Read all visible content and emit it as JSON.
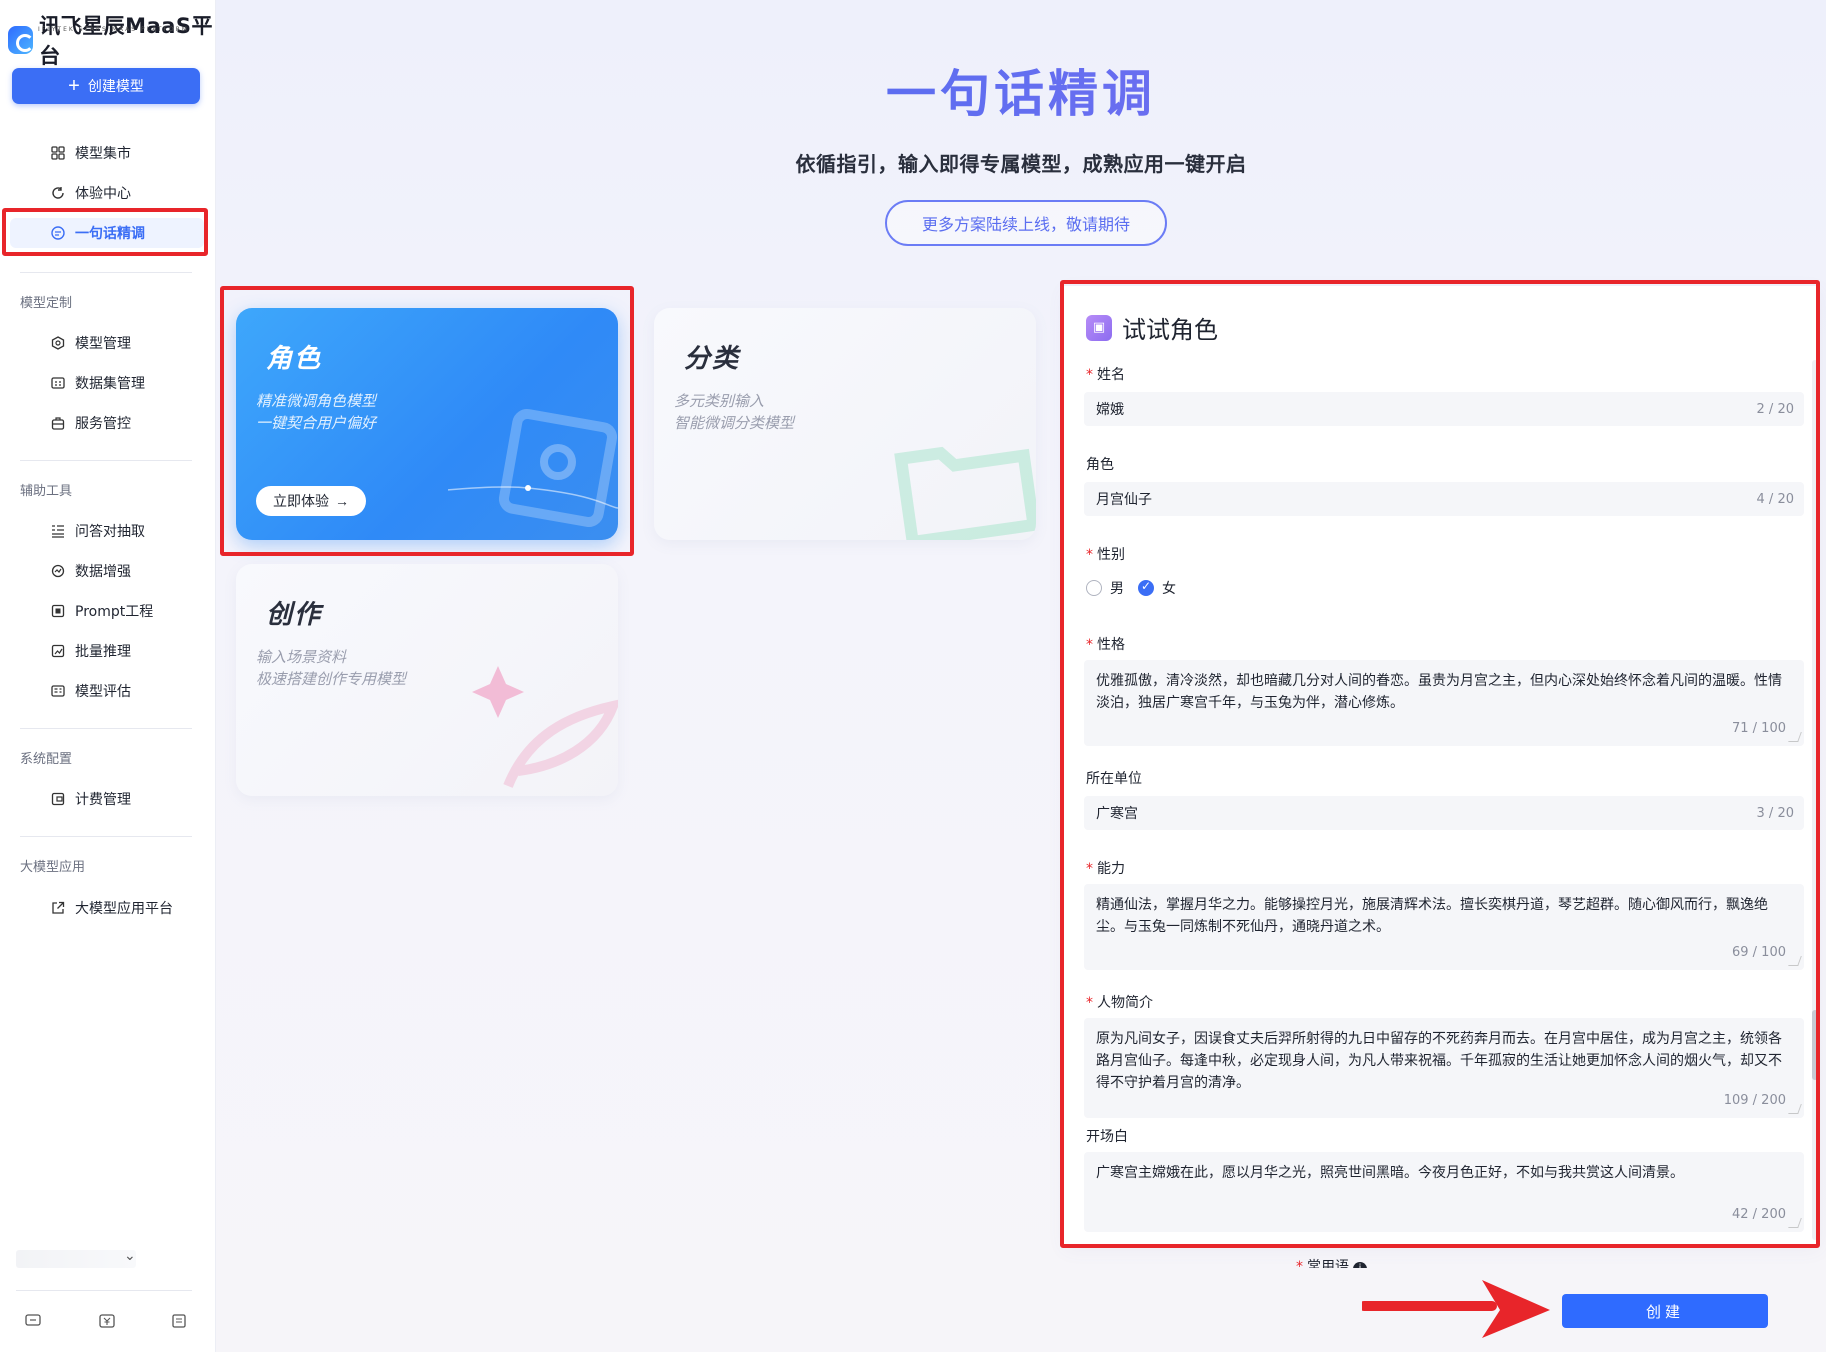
{
  "brand": {
    "name": "讯飞星辰MaaS平台",
    "subtitle": "IFLYTEK STARS MAAS PLATFORM"
  },
  "sidebar": {
    "create_button": "创建模型",
    "top_items": [
      {
        "label": "模型集市",
        "icon": "grid-icon"
      },
      {
        "label": "体验中心",
        "icon": "refresh-icon"
      },
      {
        "label": "一句话精调",
        "icon": "tune-icon",
        "active": true
      }
    ],
    "sections": [
      {
        "title": "模型定制",
        "items": [
          {
            "label": "模型管理",
            "icon": "model-icon"
          },
          {
            "label": "数据集管理",
            "icon": "dataset-icon"
          },
          {
            "label": "服务管控",
            "icon": "service-icon"
          }
        ]
      },
      {
        "title": "辅助工具",
        "items": [
          {
            "label": "问答对抽取",
            "icon": "list-icon"
          },
          {
            "label": "数据增强",
            "icon": "enhance-icon"
          },
          {
            "label": "Prompt工程",
            "icon": "prompt-icon"
          },
          {
            "label": "批量推理",
            "icon": "chart-icon"
          },
          {
            "label": "模型评估",
            "icon": "eval-icon"
          }
        ]
      },
      {
        "title": "系统配置",
        "items": [
          {
            "label": "计费管理",
            "icon": "billing-icon"
          }
        ]
      },
      {
        "title": "大模型应用",
        "items": [
          {
            "label": "大模型应用平台",
            "icon": "external-link-icon"
          }
        ]
      }
    ],
    "bottom_icons": [
      "chat-icon",
      "yen-icon",
      "doc-icon"
    ]
  },
  "hero": {
    "title": "一句话精调",
    "subtitle": "依循指引，输入即得专属模型，成熟应用一键开启",
    "notice": "更多方案陆续上线，敬请期待"
  },
  "cards": [
    {
      "title": "角色",
      "desc1": "精准微调角色模型",
      "desc2": "一键契合用户偏好",
      "button": "立即体验"
    },
    {
      "title": "分类",
      "desc1": "多元类别输入",
      "desc2": "智能微调分类模型"
    },
    {
      "title": "创作",
      "desc1": "输入场景资料",
      "desc2": "极速搭建创作专用模型"
    }
  ],
  "form": {
    "title": "试试角色",
    "fields": {
      "name": {
        "label": "姓名",
        "required": true,
        "value": "嫦娥",
        "count": "2 / 20"
      },
      "role": {
        "label": "角色",
        "required": false,
        "value": "月宫仙子",
        "count": "4 / 20"
      },
      "gender": {
        "label": "性别",
        "required": true,
        "options": [
          "男",
          "女"
        ],
        "selected": "女"
      },
      "personality": {
        "label": "性格",
        "required": true,
        "value": "优雅孤傲，清冷淡然，却也暗藏几分对人间的眷恋。虽贵为月宫之主，但内心深处始终怀念着凡间的温暖。性情淡泊，独居广寒宫千年，与玉兔为伴，潜心修炼。",
        "count": "71 / 100"
      },
      "unit": {
        "label": "所在单位",
        "required": false,
        "value": "广寒宫",
        "count": "3 / 20"
      },
      "ability": {
        "label": "能力",
        "required": true,
        "value": "精通仙法，掌握月华之力。能够操控月光，施展清辉术法。擅长奕棋丹道，琴艺超群。随心御风而行，飘逸绝尘。与玉兔一同炼制不死仙丹，通晓丹道之术。",
        "count": "69 / 100"
      },
      "bio": {
        "label": "人物简介",
        "required": true,
        "value": "原为凡间女子，因误食丈夫后羿所射得的九日中留存的不死药奔月而去。在月宫中居住，成为月宫之主，统领各路月宫仙子。每逢中秋，必定现身人间，为凡人带来祝福。千年孤寂的生活让她更加怀念人间的烟火气，却又不得不守护着月宫的清净。",
        "count": "109 / 200"
      },
      "opening": {
        "label": "开场白",
        "required": false,
        "value": "广寒宫主嫦娥在此，愿以月华之光，照亮世间黑暗。今夜月色正好，不如与我共赏这人间清景。",
        "count": "42 / 200"
      },
      "common": {
        "label": "常用语",
        "required": true
      }
    },
    "submit": "创建"
  },
  "colors": {
    "accent": "#3b6ef5",
    "highlight": "#e8252a",
    "card_blue": "#2f8af7"
  }
}
